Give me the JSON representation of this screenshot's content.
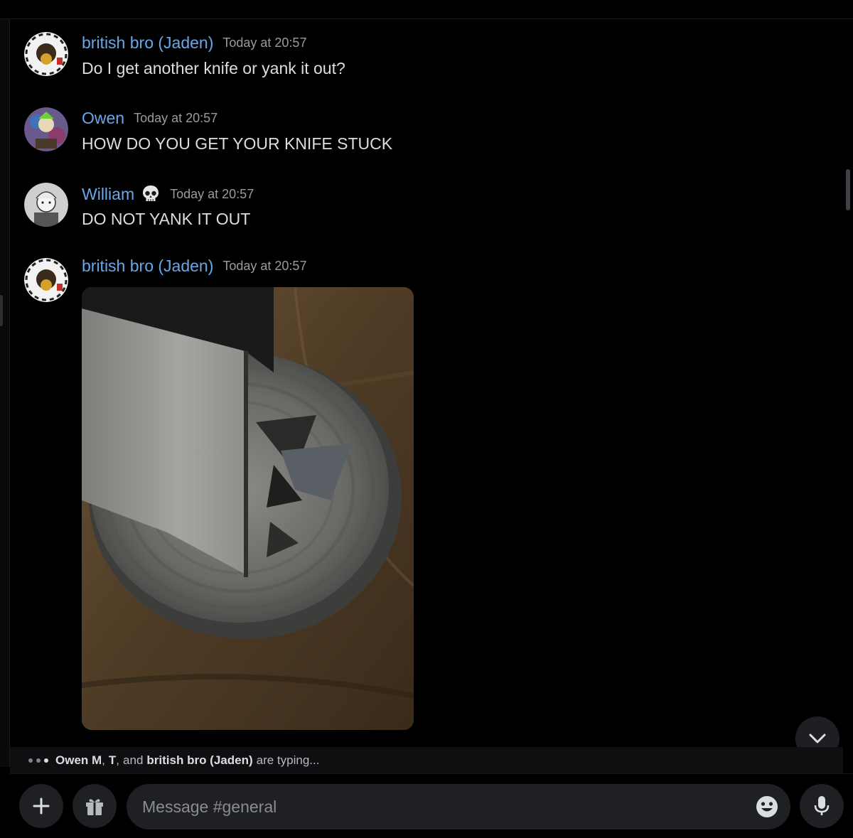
{
  "messages": [
    {
      "username": "british bro (Jaden)",
      "timestamp": "Today at 20:57",
      "text": "Do I get another knife or yank it out?"
    },
    {
      "username": "Owen",
      "timestamp": "Today at 20:57",
      "text": "HOW DO YOU GET YOUR KNIFE STUCK"
    },
    {
      "username": "William",
      "timestamp": "Today at 20:57",
      "text": "DO NOT YANK IT OUT",
      "badge": "skull-icon"
    },
    {
      "username": "british bro (Jaden)",
      "timestamp": "Today at 20:57",
      "attachment": "image"
    }
  ],
  "typing": {
    "user1": "Owen M",
    "user2": "T",
    "and_word": "and",
    "user3": "british bro (Jaden)",
    "suffix": "are typing..."
  },
  "composer": {
    "placeholder": "Message #general",
    "add_icon": "plus-icon",
    "gift_icon": "gift-icon",
    "emoji_icon": "emoji-icon",
    "mic_icon": "microphone-icon"
  },
  "colors": {
    "background": "#000000",
    "username": "#6aa7e8",
    "timestamp": "#9a9ba1",
    "text": "#dbdee1",
    "input_bg": "#1f2023"
  }
}
